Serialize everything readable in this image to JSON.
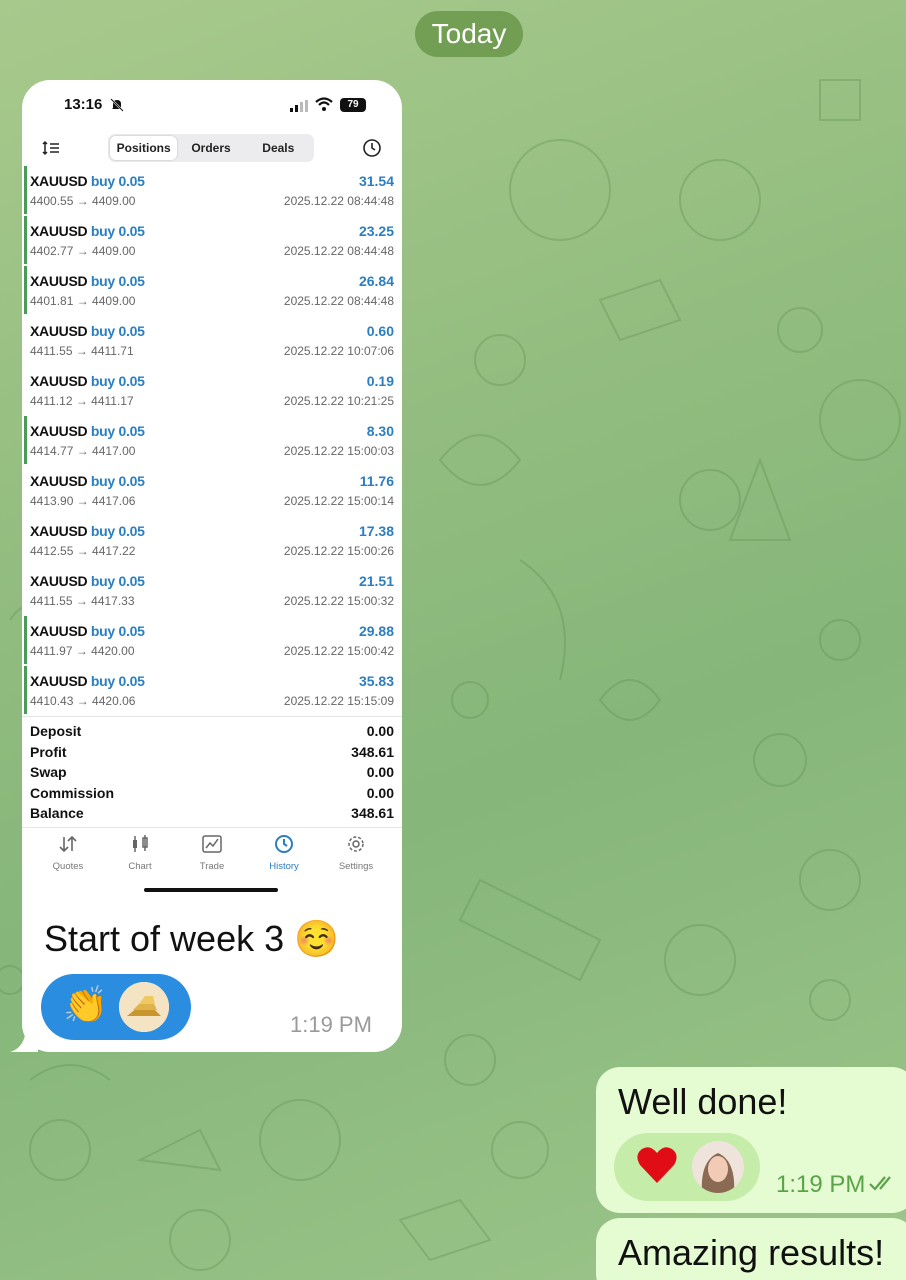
{
  "chat": {
    "date_label": "Today",
    "incoming": {
      "caption": "Start of week 3 ☺️",
      "time": "1:19 PM",
      "reaction_emoji": "👏",
      "phone": {
        "status_time": "13:16",
        "battery": "79",
        "tabs": [
          "Positions",
          "Orders",
          "Deals"
        ],
        "active_tab": "Positions",
        "positions": [
          {
            "symbol": "XAUUSD",
            "dir": "buy 0.05",
            "prices": "4400.55 → 4409.00",
            "profit": "31.54",
            "time": "2025.12.22 08:44:48",
            "bar": true
          },
          {
            "symbol": "XAUUSD",
            "dir": "buy 0.05",
            "prices": "4402.77 → 4409.00",
            "profit": "23.25",
            "time": "2025.12.22 08:44:48",
            "bar": true
          },
          {
            "symbol": "XAUUSD",
            "dir": "buy 0.05",
            "prices": "4401.81 → 4409.00",
            "profit": "26.84",
            "time": "2025.12.22 08:44:48",
            "bar": true
          },
          {
            "symbol": "XAUUSD",
            "dir": "buy 0.05",
            "prices": "4411.55 → 4411.71",
            "profit": "0.60",
            "time": "2025.12.22 10:07:06",
            "bar": false
          },
          {
            "symbol": "XAUUSD",
            "dir": "buy 0.05",
            "prices": "4411.12 → 4411.17",
            "profit": "0.19",
            "time": "2025.12.22 10:21:25",
            "bar": false
          },
          {
            "symbol": "XAUUSD",
            "dir": "buy 0.05",
            "prices": "4414.77 → 4417.00",
            "profit": "8.30",
            "time": "2025.12.22 15:00:03",
            "bar": true
          },
          {
            "symbol": "XAUUSD",
            "dir": "buy 0.05",
            "prices": "4413.90 → 4417.06",
            "profit": "11.76",
            "time": "2025.12.22 15:00:14",
            "bar": false
          },
          {
            "symbol": "XAUUSD",
            "dir": "buy 0.05",
            "prices": "4412.55 → 4417.22",
            "profit": "17.38",
            "time": "2025.12.22 15:00:26",
            "bar": false
          },
          {
            "symbol": "XAUUSD",
            "dir": "buy 0.05",
            "prices": "4411.55 → 4417.33",
            "profit": "21.51",
            "time": "2025.12.22 15:00:32",
            "bar": false
          },
          {
            "symbol": "XAUUSD",
            "dir": "buy 0.05",
            "prices": "4411.97 → 4420.00",
            "profit": "29.88",
            "time": "2025.12.22 15:00:42",
            "bar": true
          },
          {
            "symbol": "XAUUSD",
            "dir": "buy 0.05",
            "prices": "4410.43 → 4420.06",
            "profit": "35.83",
            "time": "2025.12.22 15:15:09",
            "bar": true
          }
        ],
        "summary": [
          {
            "label": "Deposit",
            "value": "0.00"
          },
          {
            "label": "Profit",
            "value": "348.61"
          },
          {
            "label": "Swap",
            "value": "0.00"
          },
          {
            "label": "Commission",
            "value": "0.00"
          },
          {
            "label": "Balance",
            "value": "348.61"
          }
        ],
        "nav": [
          {
            "label": "Quotes",
            "icon": "quotes-icon"
          },
          {
            "label": "Chart",
            "icon": "chart-icon"
          },
          {
            "label": "Trade",
            "icon": "trade-icon"
          },
          {
            "label": "History",
            "icon": "history-icon"
          },
          {
            "label": "Settings",
            "icon": "settings-icon"
          }
        ],
        "active_nav": "History"
      }
    },
    "outgoing": [
      {
        "text": "Well done!",
        "time": "1:19 PM",
        "reaction_emoji": "❤️"
      },
      {
        "text": "Amazing results!"
      }
    ]
  },
  "colors": {
    "accent_blue": "#2a7ec2",
    "outgoing_bubble": "#e5fbd2",
    "chat_background": "#93bd80"
  }
}
